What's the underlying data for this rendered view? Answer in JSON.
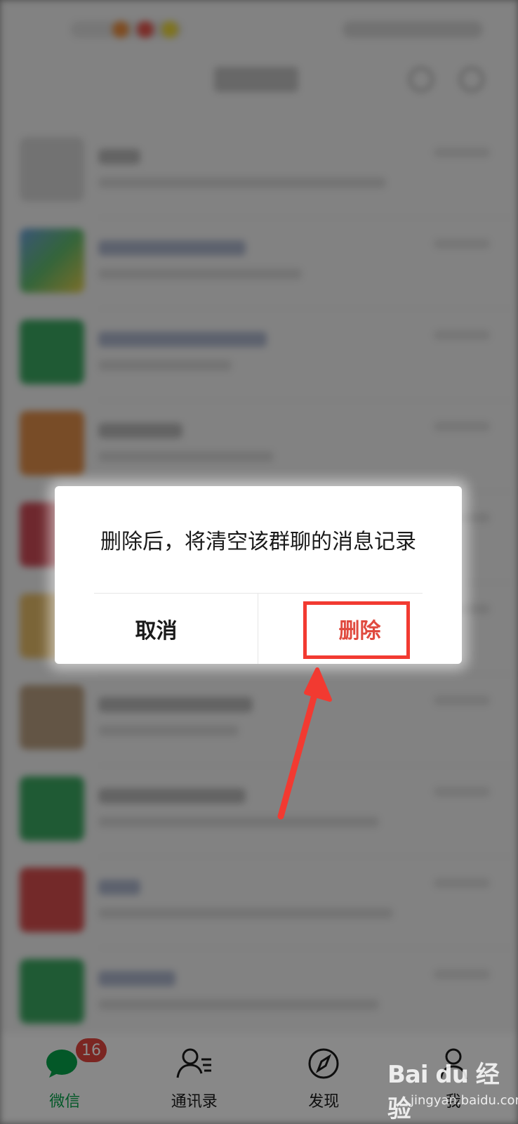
{
  "dialog": {
    "message": "删除后，将清空该群聊的消息记录",
    "cancel_label": "取消",
    "delete_label": "删除"
  },
  "tabbar": {
    "tabs": [
      {
        "label": "微信",
        "badge": "16",
        "active": true,
        "icon": "chat-icon"
      },
      {
        "label": "通讯录",
        "active": false,
        "icon": "contacts-icon"
      },
      {
        "label": "发现",
        "active": false,
        "icon": "compass-icon"
      },
      {
        "label": "我",
        "active": false,
        "icon": "person-icon"
      }
    ]
  },
  "watermark": {
    "brand": "Bai du 经验",
    "url": "jingyan.baidu.com"
  },
  "colors": {
    "accent_green": "#07a14a",
    "delete_red": "#e04a3f",
    "badge_red": "#e0463e",
    "annotation_red": "#f23a31"
  }
}
